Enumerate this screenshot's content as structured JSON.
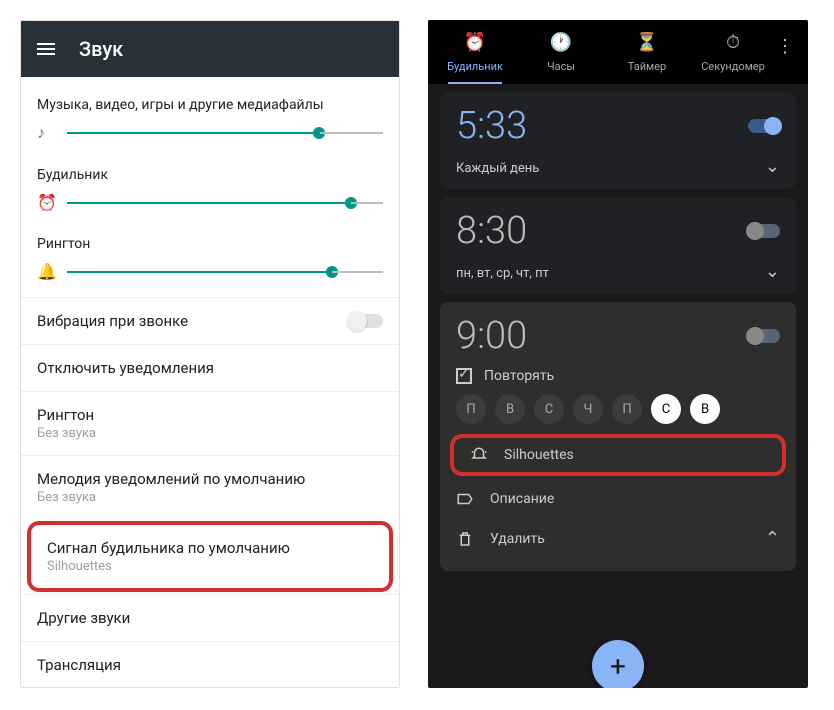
{
  "left": {
    "title": "Звук",
    "sliders": {
      "media": {
        "label": "Музыка, видео, игры и другие медиафайлы",
        "pos": 78
      },
      "alarm": {
        "label": "Будильник",
        "pos": 88
      },
      "ring": {
        "label": "Рингтон",
        "pos": 82
      }
    },
    "vibrate": "Вибрация при звонке",
    "mute": "Отключить уведомления",
    "ringtone": {
      "title": "Рингтон",
      "sub": "Без звука"
    },
    "notif": {
      "title": "Мелодия уведомлений по умолчанию",
      "sub": "Без звука"
    },
    "alarm_tone": {
      "title": "Сигнал будильника по умолчанию",
      "sub": "Silhouettes"
    },
    "other": "Другие звуки",
    "cast": "Трансляция"
  },
  "right": {
    "tabs": {
      "alarm": "Будильник",
      "clock": "Часы",
      "timer": "Таймер",
      "stopwatch": "Секундомер"
    },
    "alarms": {
      "a1": {
        "time": "5:33",
        "days": "Каждый день"
      },
      "a2": {
        "time": "8:30",
        "days": "пн, вт, ср, чт, пт"
      },
      "a3": {
        "time": "9:00",
        "repeat": "Повторять",
        "day_labels": [
          "П",
          "В",
          "С",
          "Ч",
          "П",
          "С",
          "В"
        ],
        "day_on": [
          false,
          false,
          false,
          false,
          false,
          true,
          true
        ],
        "tone": "Silhouettes",
        "desc": "Описание",
        "del": "Удалить"
      }
    }
  }
}
